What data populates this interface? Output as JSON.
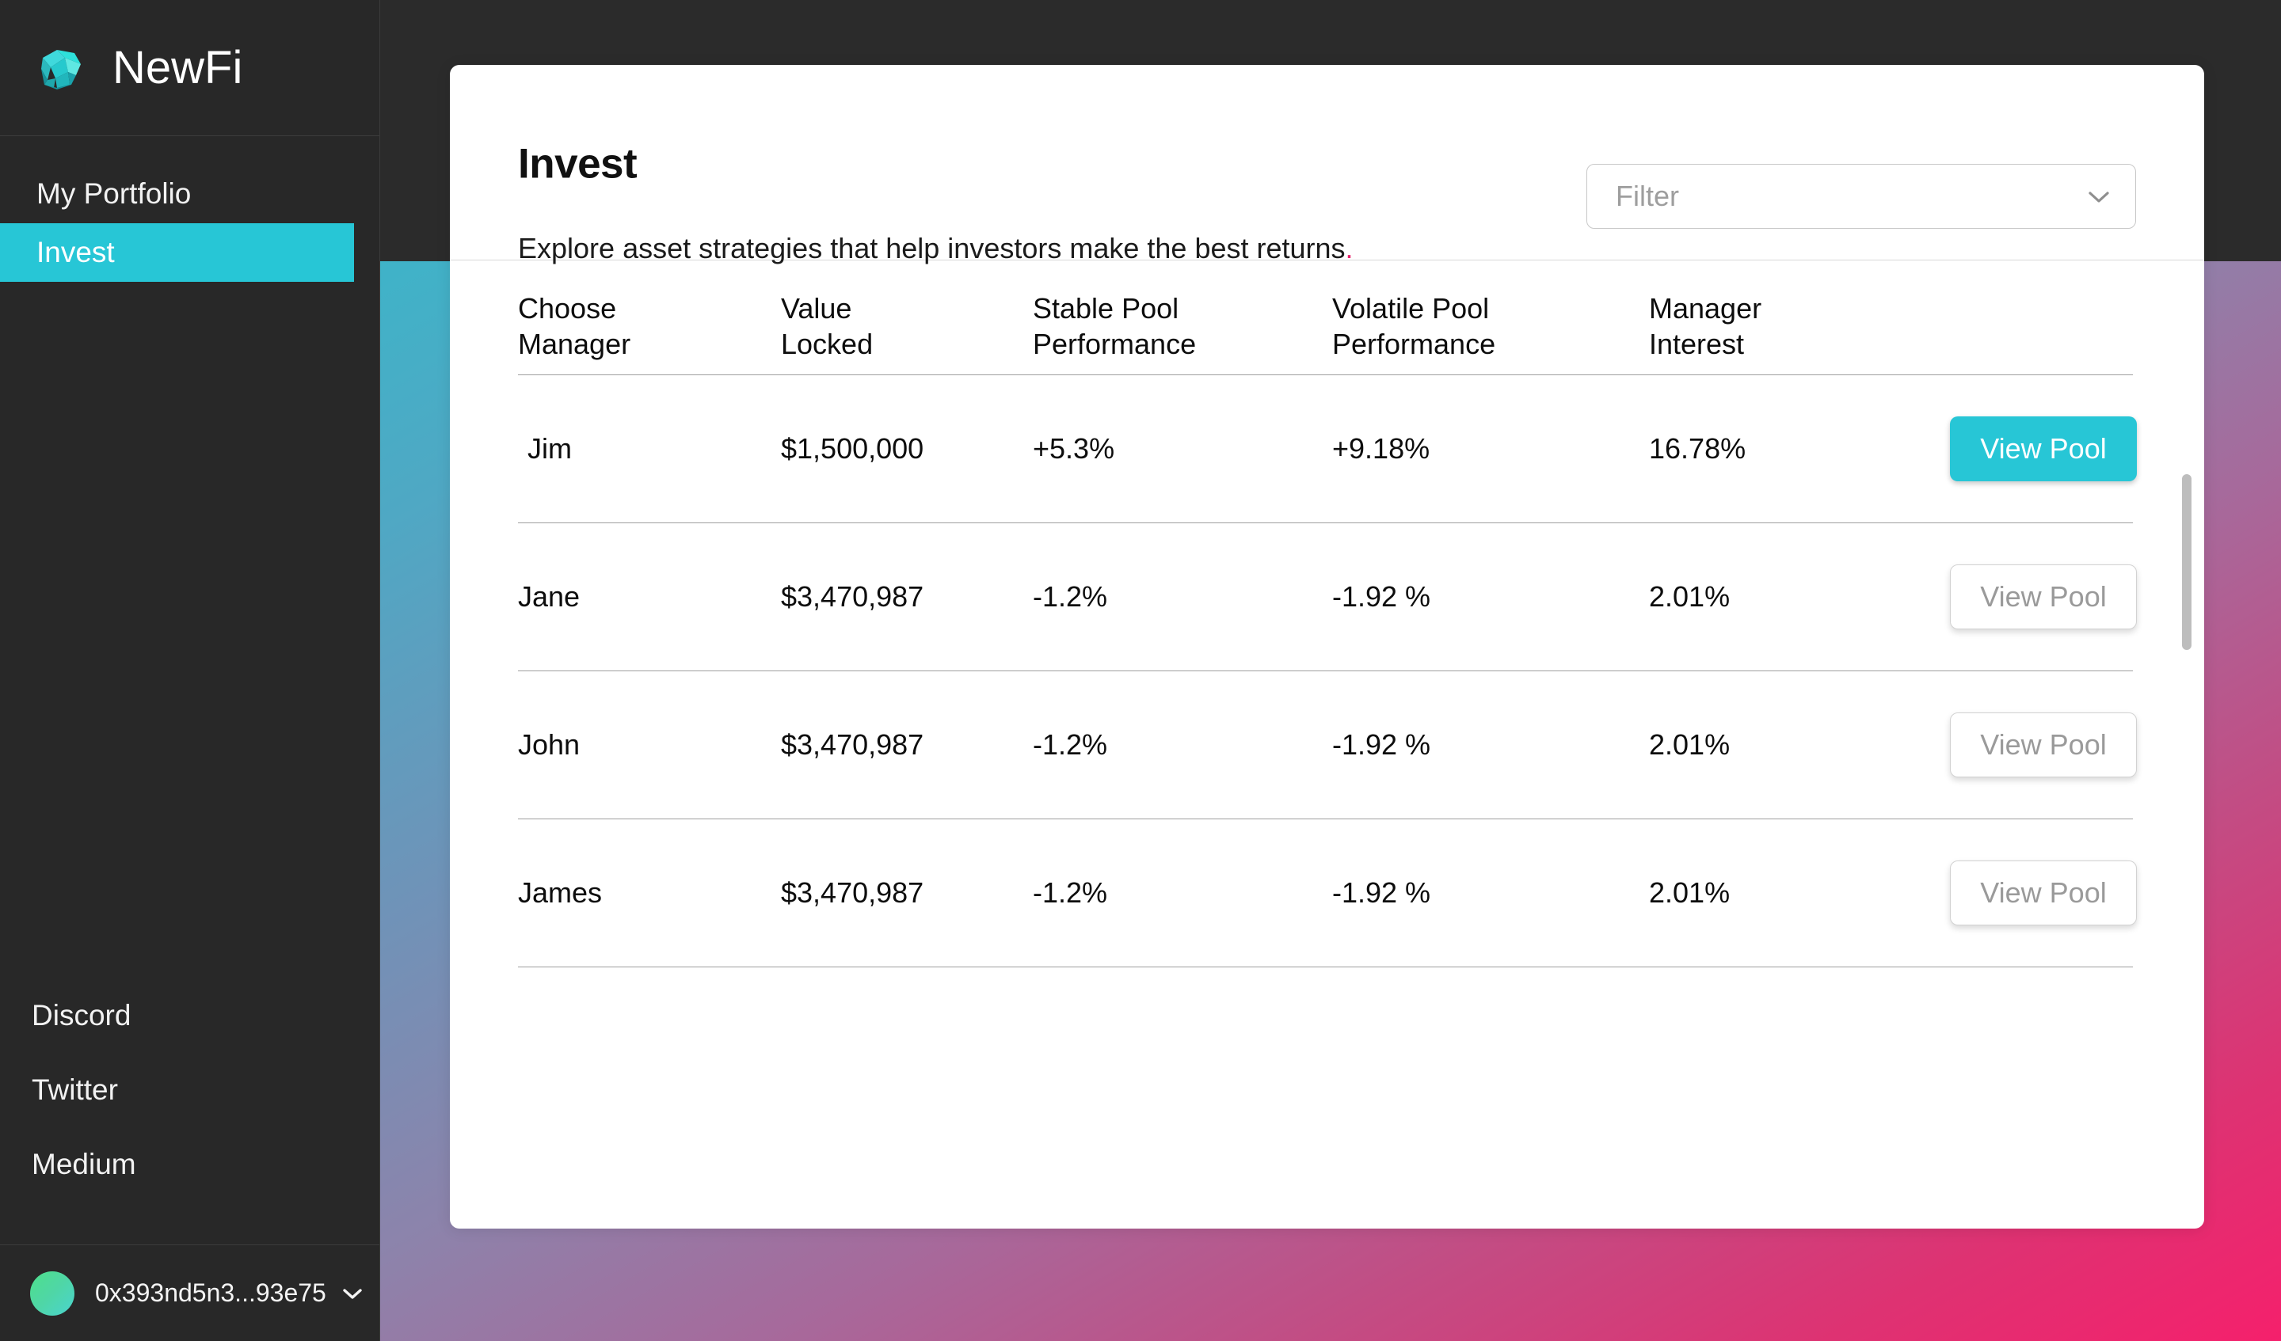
{
  "brand": {
    "name": "NewFi",
    "logo_icon": "gem-icon"
  },
  "sidebar": {
    "nav": [
      {
        "label": "My Portfolio",
        "active": false
      },
      {
        "label": "Invest",
        "active": true
      }
    ],
    "social": [
      {
        "label": "Discord"
      },
      {
        "label": "Twitter"
      },
      {
        "label": "Medium"
      }
    ],
    "wallet": {
      "address": "0x393nd5n3...93e75",
      "caret_icon": "chevron-down-icon",
      "avatar_icon": "avatar"
    }
  },
  "page": {
    "title": "Invest",
    "subtitle": "Explore asset strategies that help investors make the best returns",
    "subtitle_dot": ".",
    "filter": {
      "placeholder": "Filter",
      "value": "",
      "caret_icon": "chevron-down-icon"
    }
  },
  "table": {
    "columns": [
      {
        "line1": "Choose",
        "line2": "Manager"
      },
      {
        "line1": "Value",
        "line2": "Locked"
      },
      {
        "line1": "Stable Pool",
        "line2": "Performance"
      },
      {
        "line1": "Volatile Pool",
        "line2": "Performance"
      },
      {
        "line1": "Manager",
        "line2": "Interest"
      },
      {
        "line1": "",
        "line2": ""
      }
    ],
    "rows": [
      {
        "manager": "Jim",
        "value_locked": "$1,500,000",
        "stable_performance": "+5.3%",
        "volatile_performance": "+9.18%",
        "manager_interest": "16.78%",
        "action_label": "View Pool",
        "action_state": "primary"
      },
      {
        "manager": "Jane",
        "value_locked": "$3,470,987",
        "stable_performance": "-1.2%",
        "volatile_performance": "-1.92 %",
        "manager_interest": "2.01%",
        "action_label": "View Pool",
        "action_state": "ghost"
      },
      {
        "manager": "John",
        "value_locked": "$3,470,987",
        "stable_performance": "-1.2%",
        "volatile_performance": "-1.92 %",
        "manager_interest": "2.01%",
        "action_label": "View Pool",
        "action_state": "ghost"
      },
      {
        "manager": "James",
        "value_locked": "$3,470,987",
        "stable_performance": "-1.2%",
        "volatile_performance": "-1.92 %",
        "manager_interest": "2.01%",
        "action_label": "View Pool",
        "action_state": "ghost"
      }
    ]
  },
  "colors": {
    "accent_cyan": "#27c6d6",
    "accent_pink": "#e8246b",
    "sidebar_bg": "#282828",
    "gradient_start": "#3fb3c8",
    "gradient_end": "#f5206c"
  }
}
